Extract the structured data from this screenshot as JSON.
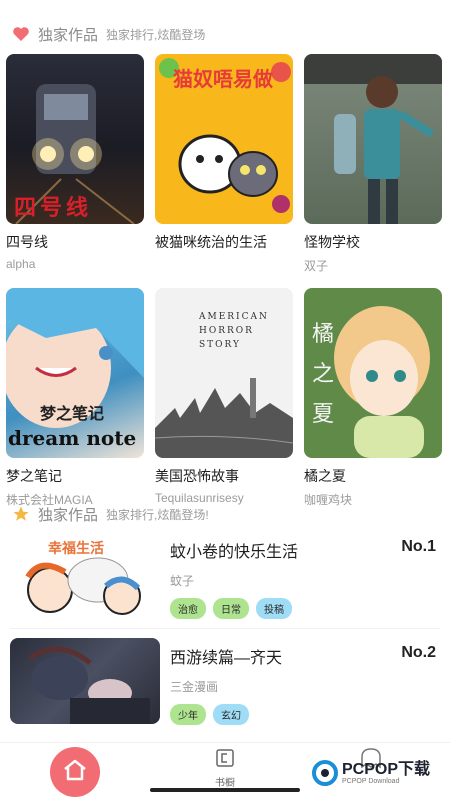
{
  "section1": {
    "title": "独家作品",
    "subtitle": "独家排行,炫酷登场",
    "icon": "heart-icon",
    "icon_color": "#f26d73"
  },
  "books": [
    {
      "name": "四号线",
      "author": "alpha",
      "cover_text": "四号线"
    },
    {
      "name": "被猫咪统治的生活",
      "author": "",
      "cover_text": "猫奴唔易做"
    },
    {
      "name": "怪物学校",
      "author": "双子",
      "cover_text": ""
    },
    {
      "name": "梦之笔记",
      "author": "株式会社MAGIA",
      "cover_text": "梦之笔记",
      "cover_text2": "dream note"
    },
    {
      "name": "美国恐怖故事",
      "author": "Tequilasunrisesy",
      "cover_text": "AMERICAN HORROR STORY"
    },
    {
      "name": "橘之夏",
      "author": "咖喱鸡块",
      "cover_text": "橘之夏"
    }
  ],
  "section2": {
    "title": "独家作品",
    "subtitle": "独家排行,炫酷登场!",
    "icon": "star-icon",
    "icon_color": "#f4b942"
  },
  "ranking": [
    {
      "title": "蚊小卷的快乐生活",
      "rank": "No.1",
      "author": "蚊子",
      "thumb_text": "幸福生活",
      "tags": [
        "治愈",
        "日常",
        "投稿"
      ]
    },
    {
      "title": "西游续篇—齐天",
      "rank": "No.2",
      "author": "三金漫画",
      "thumb_text": "",
      "tags": [
        "少年",
        "玄幻"
      ]
    }
  ],
  "tabbar": {
    "home_icon": "home-icon",
    "shelf_label": "书橱",
    "shelf_icon": "bookshelf-icon",
    "third_icon": "ghost-icon"
  },
  "watermark": {
    "text": "PCPOP下载",
    "sub": "PCPOP Download"
  },
  "colors": {
    "accent": "#f26d73",
    "tag_green": "#aee38f",
    "tag_blue": "#9fdcf5"
  }
}
